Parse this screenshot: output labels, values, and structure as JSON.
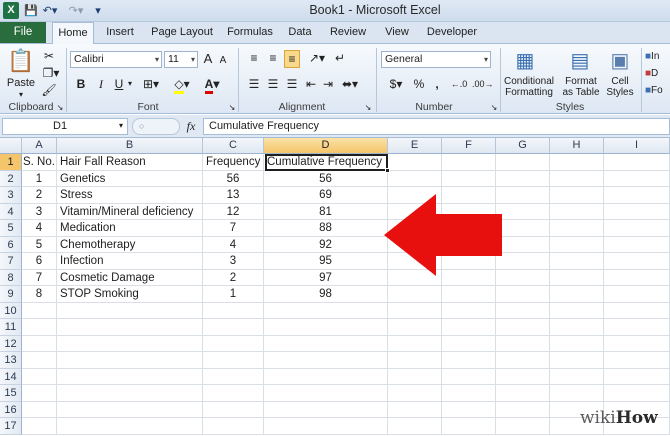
{
  "window": {
    "title": "Book1  -  Microsoft Excel",
    "app_icon": "X"
  },
  "ribbon_tabs": [
    "File",
    "Home",
    "Insert",
    "Page Layout",
    "Formulas",
    "Data",
    "Review",
    "View",
    "Developer"
  ],
  "clipboard": {
    "paste_label": "Paste",
    "group_label": "Clipboard"
  },
  "font": {
    "name": "Calibri",
    "size": "11",
    "bold": "B",
    "italic": "I",
    "underline": "U",
    "grow": "A",
    "shrink": "A",
    "group_label": "Font"
  },
  "alignment": {
    "group_label": "Alignment"
  },
  "number": {
    "format": "General",
    "currency": "$",
    "percent": "%",
    "comma": ",",
    "group_label": "Number"
  },
  "styles": {
    "conditional_formatting": "Conditional\nFormatting",
    "format_as_table": "Format\nas Table",
    "cell_styles": "Cell\nStyles",
    "group_label": "Styles"
  },
  "cells_group": {
    "insert_partial": "In",
    "delete_partial": "D",
    "format_partial": "Fo"
  },
  "formula_bar": {
    "name_box": "D1",
    "fx": "fx",
    "content": "Cumulative Frequency"
  },
  "columns": [
    "A",
    "B",
    "C",
    "D",
    "E",
    "F",
    "G",
    "H",
    "I"
  ],
  "selected_column": "D",
  "rows": [
    "1",
    "2",
    "3",
    "4",
    "5",
    "6",
    "7",
    "8",
    "9",
    "10",
    "11",
    "12",
    "13",
    "14",
    "15",
    "16",
    "17"
  ],
  "table": {
    "headers": [
      "S. No.",
      "Hair Fall Reason",
      "Frequency",
      "Cumulative Frequency"
    ],
    "data": [
      [
        "1",
        "Genetics",
        "56",
        "56"
      ],
      [
        "2",
        "Stress",
        "13",
        "69"
      ],
      [
        "3",
        "Vitamin/Mineral deficiency",
        "12",
        "81"
      ],
      [
        "4",
        "Medication",
        "7",
        "88"
      ],
      [
        "5",
        "Chemotherapy",
        "4",
        "92"
      ],
      [
        "6",
        "Infection",
        "3",
        "95"
      ],
      [
        "7",
        "Cosmetic Damage",
        "2",
        "97"
      ],
      [
        "8",
        "STOP Smoking",
        "1",
        "98"
      ]
    ]
  },
  "watermark": {
    "part1": "wiki",
    "part2": "How"
  },
  "colors": {
    "file_tab": "#2a6d3c",
    "selection": "#f4c56b",
    "arrow": "#e80f0f"
  }
}
